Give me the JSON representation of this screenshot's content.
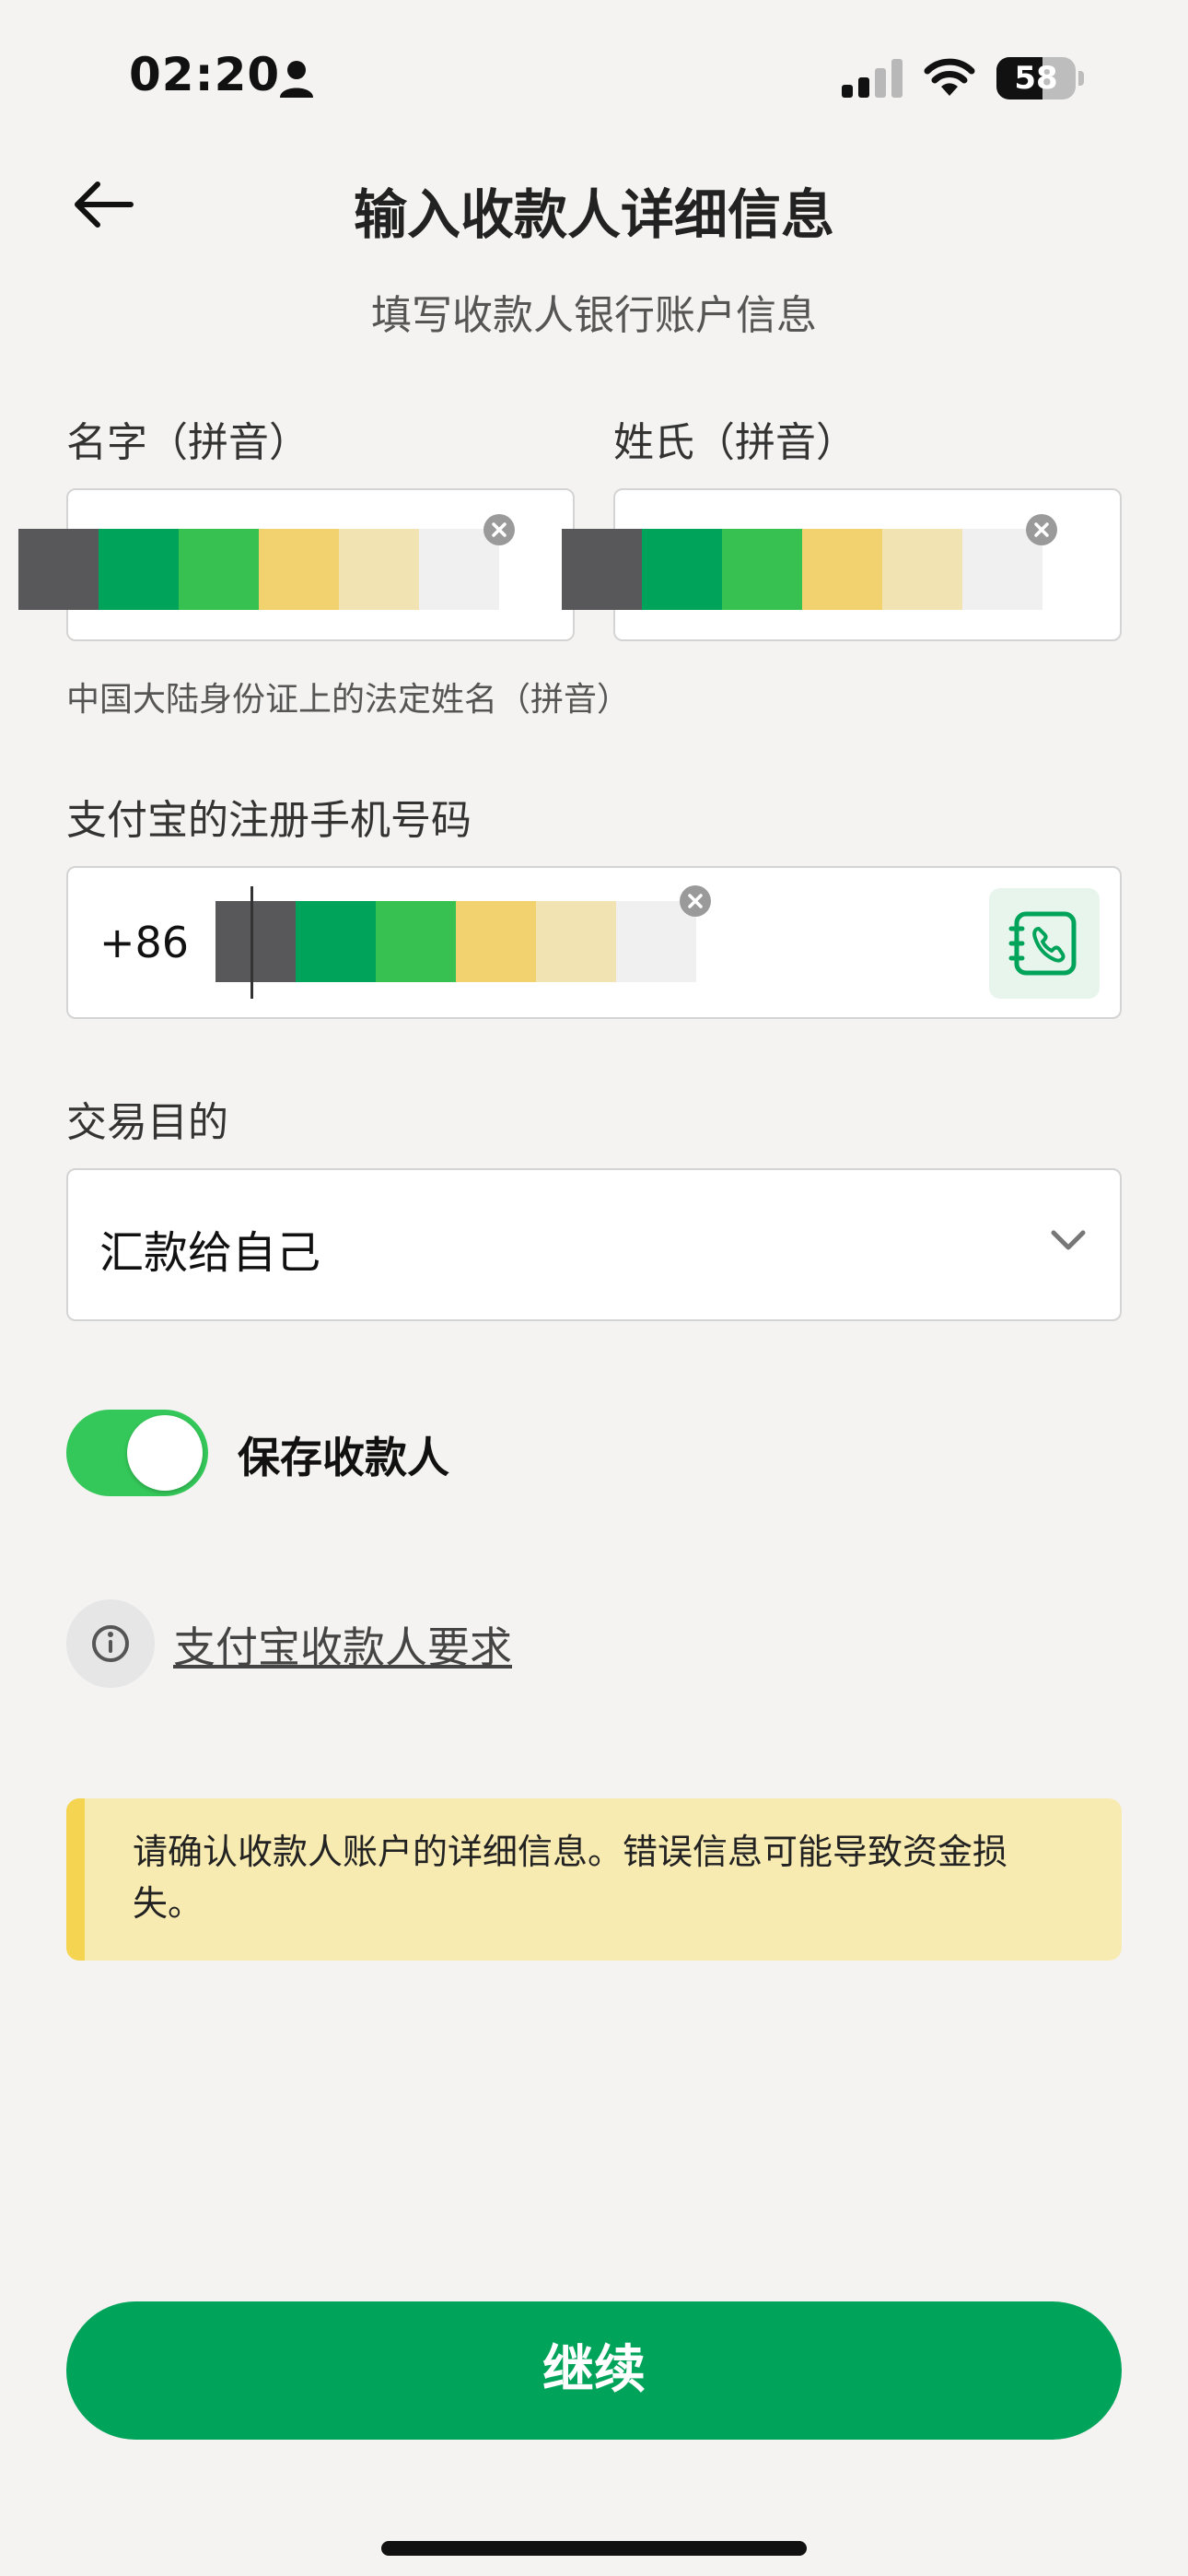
{
  "status_bar": {
    "time": "02:20",
    "battery_percent": "58",
    "battery_level": 0.58,
    "icons": [
      "person-icon",
      "cellular-signal-icon",
      "wifi-icon",
      "battery-icon"
    ]
  },
  "header": {
    "back_icon": "arrow-left-icon",
    "title": "输入收款人详细信息",
    "subtitle": "填写收款人银行账户信息"
  },
  "form": {
    "first_name": {
      "label": "名字（拼音）",
      "clear_icon": "clear-icon"
    },
    "last_name": {
      "label": "姓氏（拼音）",
      "clear_icon": "clear-icon"
    },
    "name_hint": "中国大陆身份证上的法定姓名（拼音）",
    "phone": {
      "label": "支付宝的注册手机号码",
      "prefix": "+86",
      "clear_icon": "clear-icon",
      "contacts_icon": "contacts-book-icon"
    },
    "purpose": {
      "label": "交易目的",
      "selected": "汇款给自己",
      "dropdown_icon": "chevron-down-icon"
    },
    "masked_colors": [
      "#58585a",
      "#00a35a",
      "#36c151",
      "#f2d26e",
      "#f2e4b2",
      "#f0f0f0"
    ]
  },
  "save_payee": {
    "label": "保存收款人",
    "enabled": true
  },
  "info": {
    "icon": "info-icon",
    "link_text": "支付宝收款人要求"
  },
  "warning": {
    "text": "请确认收款人账户的详细信息。错误信息可能导致资金损失。"
  },
  "footer": {
    "continue_label": "继续"
  },
  "colors": {
    "brand_green": "#00a35a",
    "toggle_green": "#34c759",
    "warning_bg": "#f8ebb2",
    "warning_bar": "#f5d452",
    "background": "#f4f3f1"
  }
}
